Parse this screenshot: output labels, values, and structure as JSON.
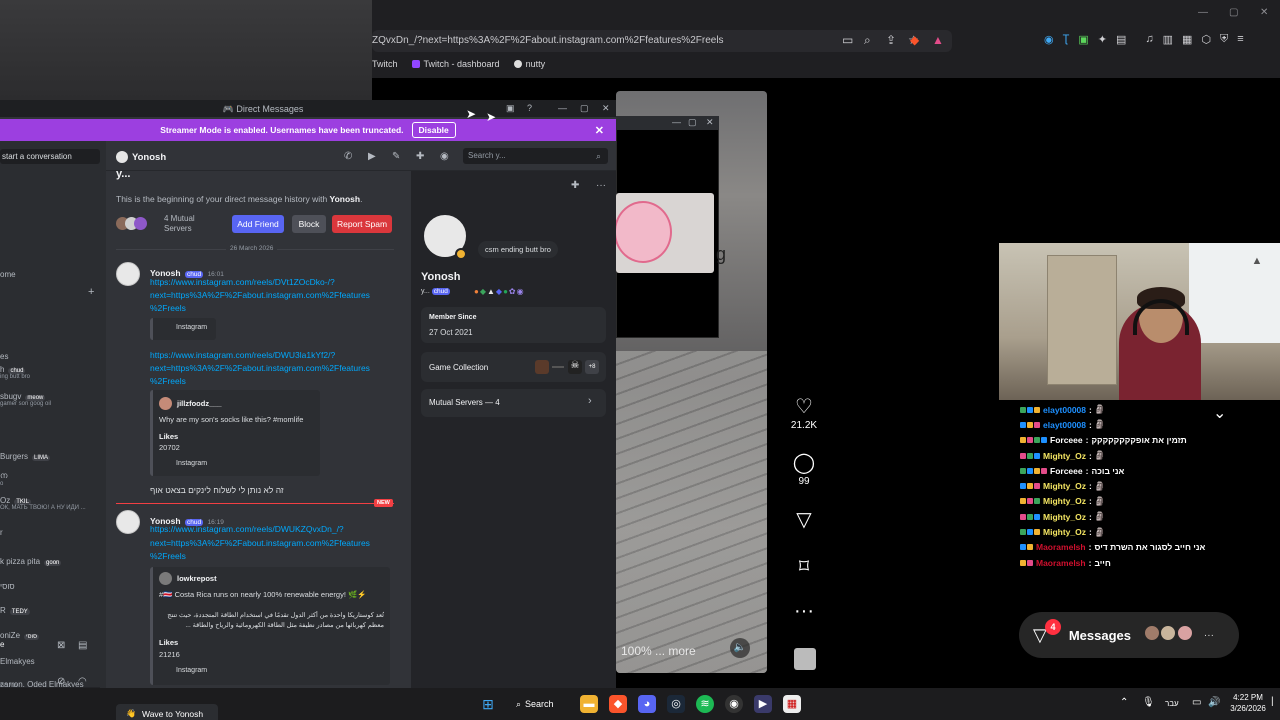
{
  "browser": {
    "url": "ZQvxDn_/?next=https%3A%2F%2Fabout.instagram.com%2Ffeatures%2Freels",
    "bookmarks": [
      "Twitch",
      "Twitch - dashboard",
      "nutty"
    ]
  },
  "discord": {
    "window_title": "Direct Messages",
    "banner_text": "Streamer Mode is enabled. Usernames have been truncated.",
    "banner_button": "Disable",
    "sidebar": {
      "search_placeholder": "start a conversation",
      "items": [
        {
          "label": "ome",
          "sub": ""
        },
        {
          "label": "es",
          "sub": ""
        },
        {
          "label": "h",
          "tag": "chud",
          "sub": "ing butt bro"
        },
        {
          "label": "sbugv",
          "tag": "meow",
          "sub": "gamer son goog oil"
        },
        {
          "label": "Burgers",
          "tag": "LIMA",
          "sub": ""
        },
        {
          "label": "ന",
          "sub": "o"
        },
        {
          "label": "Oz",
          "tag": "TKIL",
          "sub": "ОК, МАТЬ ТВОЮ! А НУ ИДИ ..."
        },
        {
          "label": "r",
          "sub": ""
        },
        {
          "label": "k pizza pita",
          "tag": "goon",
          "sub": ""
        },
        {
          "label": "סוסי",
          "sub": ""
        },
        {
          "label": "R",
          "tag": "TEDY",
          "sub": ""
        },
        {
          "label": "oniZe",
          "tag": "סוסי",
          "sub": ""
        },
        {
          "label": "Elmakyes",
          "sub": ""
        },
        {
          "label": "zarron, Oded Elmakyes",
          "sub": ""
        }
      ],
      "bottom_label": "e",
      "bottom_sub": "ים / הח"
    },
    "dm": {
      "header_name": "Yonosh",
      "search_placeholder": "Search y...",
      "intro_name": "y...",
      "intro_text_prefix": "This is the beginning of your direct message history with ",
      "intro_text_name": "Yonosh",
      "intro_text_suffix": ".",
      "mutual": "4 Mutual",
      "mutual2": "Servers",
      "btn_add": "Add Friend",
      "btn_block": "Block",
      "btn_spam": "Report Spam",
      "date_divider": "26 March 2026",
      "messages": [
        {
          "author": "Yonosh",
          "badge": "chud",
          "time": "16:01",
          "link_lines": [
            "https://www.instagram.com/reels/DVt1ZOcDko-/?",
            "next=https%3A%2F%2Fabout.instagram.com%2Ffeatures",
            "%2Freels"
          ],
          "embed_title": "Instagram"
        },
        {
          "link_lines": [
            "https://www.instagram.com/reels/DWU3la1kYf2/?",
            "next=https%3A%2F%2Fabout.instagram.com%2Ffeatures",
            "%2Freels"
          ],
          "embed_author": "jillzfoodz___",
          "embed_desc": "Why are my son's socks like this? #momlife",
          "embed_field": "Likes",
          "embed_field_val": "20702",
          "embed_title": "Instagram"
        },
        {
          "text": "זה לא נותן לי לשלוח לינקים בצאט אוף"
        },
        {
          "author": "Yonosh",
          "badge": "chud",
          "time": "16:19",
          "link_lines": [
            "https://www.instagram.com/reels/DWUKZQvxDn_/?",
            "next=https%3A%2F%2Fabout.instagram.com%2Ffeatures",
            "%2Freels"
          ],
          "embed_author": "lowkrepost",
          "embed_desc": "#🇨🇷 Costa Rica runs on nearly 100% renewable energy! 🌿⚡",
          "embed_desc2": "تُعد كوستاريكا واحدة من أكثر الدول تقدمًا في استخدام الطاقة المتجددة، حيث تنتج",
          "embed_desc3": "معظم كهربائها من مصادر نظيفة مثل الطاقة الكهرومائية والرياح والطاقة ...",
          "embed_field": "Likes",
          "embed_field_val": "21216",
          "embed_title": "Instagram"
        }
      ],
      "new_label": "NEW",
      "wave_label": "Wave to Yonosh"
    },
    "profile": {
      "status": "csm ending butt bro",
      "display_name": "Yonosh",
      "username": "y...",
      "tag": "chud",
      "member_since_label": "Member Since",
      "member_since": "27 Oct 2021",
      "game_collection": "Game Collection",
      "game_more": "+8",
      "mutual_servers": "Mutual Servers — 4"
    }
  },
  "instagram": {
    "likes": "21.2K",
    "comments": "99",
    "caption": "100% ... more",
    "popup_text": "g"
  },
  "chat": [
    {
      "user": "elayt00008",
      "color": "#1e90ff",
      "msg": "🗿"
    },
    {
      "user": "elayt00008",
      "color": "#1e90ff",
      "msg": "🗿"
    },
    {
      "user": "Forceee",
      "color": "#ffffff",
      "msg": "תזמין את אופקקקקקקקק"
    },
    {
      "user": "Mighty_Oz",
      "color": "#f5e663",
      "msg": "🗿"
    },
    {
      "user": "Forceee",
      "color": "#ffffff",
      "msg": "אני בוכה"
    },
    {
      "user": "Mighty_Oz",
      "color": "#f5e663",
      "msg": "🗿"
    },
    {
      "user": "Mighty_Oz",
      "color": "#f5e663",
      "msg": "🗿"
    },
    {
      "user": "Mighty_Oz",
      "color": "#f5e663",
      "msg": "🗿"
    },
    {
      "user": "Mighty_Oz",
      "color": "#f5e663",
      "msg": "🗿"
    },
    {
      "user": "Maoramelsh",
      "color": "#d0102e",
      "msg": "אני חייב לסגור את השרת דיס"
    },
    {
      "user": "Maoramelsh",
      "color": "#d0102e",
      "msg": "חייב"
    }
  ],
  "messages_pill": {
    "label": "Messages",
    "count": "4"
  },
  "taskbar": {
    "search": "Search",
    "lang": "עבר",
    "time": "4:22 PM",
    "date": "3/26/2026"
  }
}
